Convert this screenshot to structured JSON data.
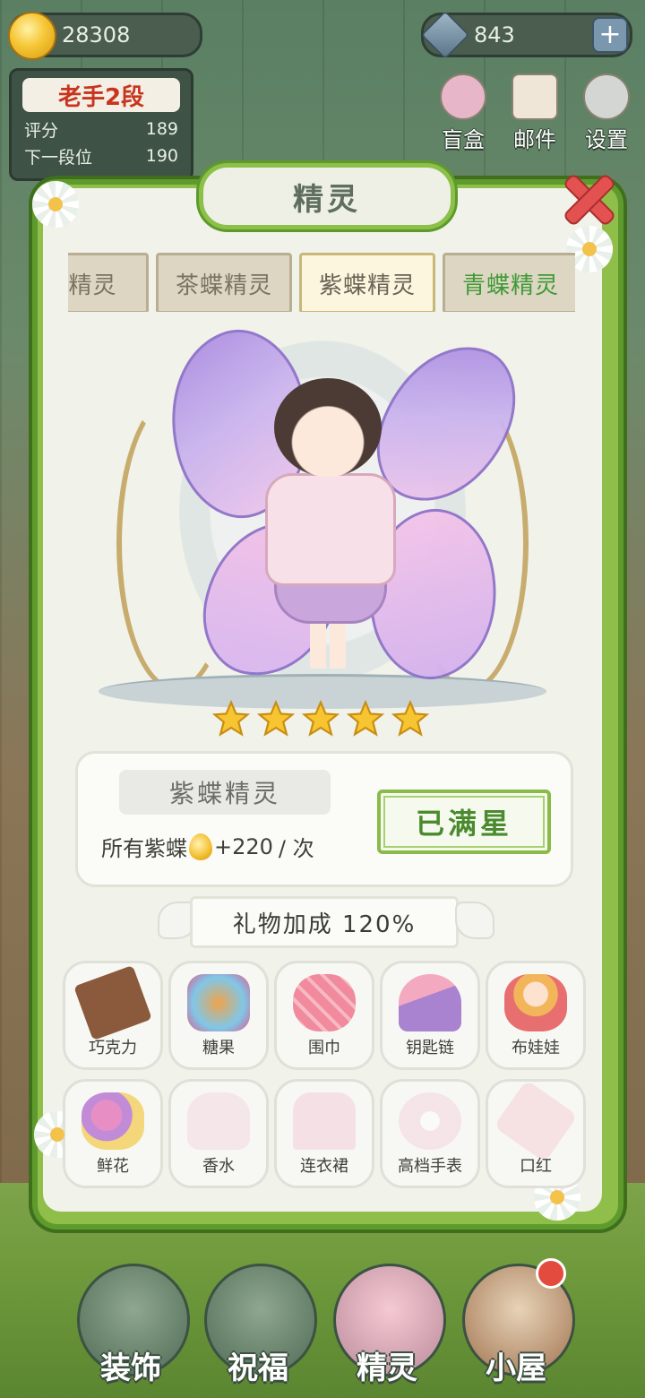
{
  "hud": {
    "gold": "28308",
    "gems": "843",
    "plus_label": "+",
    "rank_title": "老手2段",
    "score_label": "评分",
    "score_value": "189",
    "next_label": "下一段位",
    "next_value": "190"
  },
  "top_menu": [
    {
      "label": "盲盒",
      "icon": "blind-box-icon"
    },
    {
      "label": "邮件",
      "icon": "mail-icon"
    },
    {
      "label": "设置",
      "icon": "gear-icon"
    }
  ],
  "panel": {
    "title": "精灵",
    "tabs": [
      {
        "label": "蝶精灵",
        "state": "normal"
      },
      {
        "label": "茶蝶精灵",
        "state": "normal"
      },
      {
        "label": "紫蝶精灵",
        "state": "active"
      },
      {
        "label": "青蝶精灵",
        "state": "green"
      }
    ],
    "stars": 5,
    "fairy_name": "紫蝶精灵",
    "effect_prefix": "所有紫蝶",
    "effect_value": "+220",
    "effect_suffix": "/ 次",
    "max_label": "已满星",
    "bonus_label": "礼物加成 120%"
  },
  "gifts": [
    {
      "label": "巧克力",
      "icon": "chocolate-icon",
      "color": "#8b5a3c",
      "locked": false
    },
    {
      "label": "糖果",
      "icon": "candy-jar-icon",
      "color": "#f0a34a",
      "locked": false
    },
    {
      "label": "围巾",
      "icon": "scarf-icon",
      "color": "#f08a9c",
      "locked": false
    },
    {
      "label": "钥匙链",
      "icon": "keychain-icon",
      "color": "#c59ad8",
      "locked": false
    },
    {
      "label": "布娃娃",
      "icon": "doll-icon",
      "color": "#f2b55a",
      "locked": false
    },
    {
      "label": "鲜花",
      "icon": "bouquet-icon",
      "color": "#e78fc4",
      "locked": false
    },
    {
      "label": "香水",
      "icon": "perfume-icon",
      "color": "#f2c6d3",
      "locked": true
    },
    {
      "label": "连衣裙",
      "icon": "dress-icon",
      "color": "#f0b7c9",
      "locked": true
    },
    {
      "label": "高档手表",
      "icon": "watch-icon",
      "color": "#f2bed0",
      "locked": true
    },
    {
      "label": "口红",
      "icon": "lipstick-icon",
      "color": "#f3b9c3",
      "locked": true
    }
  ],
  "bottom_nav": [
    {
      "label": "装饰",
      "icon": "plant-icon"
    },
    {
      "label": "祝福",
      "icon": "butterfly-icon"
    },
    {
      "label": "精灵",
      "icon": "fairy-icon"
    },
    {
      "label": "小屋",
      "icon": "house-icon"
    }
  ],
  "colors": {
    "frame_green": "#8fbf4a",
    "accent_green": "#4b8a2e",
    "close_red": "#e35151",
    "rank_red": "#c9341e"
  }
}
